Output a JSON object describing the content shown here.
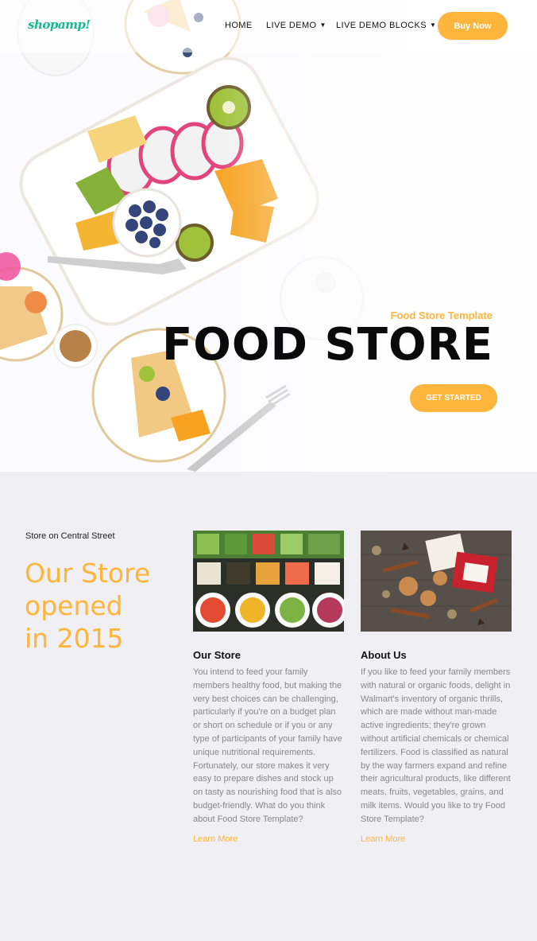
{
  "brand": {
    "logo": "shopamp!",
    "accent": "#fdb53c",
    "logo_color": "#1bb88f"
  },
  "nav": {
    "items": [
      {
        "label": "HOME",
        "has_dropdown": false
      },
      {
        "label": "LIVE DEMO",
        "has_dropdown": true
      },
      {
        "label": "LIVE DEMO BLOCKS",
        "has_dropdown": true
      }
    ],
    "cta": "Buy Now",
    "dropdown_icon": "caret-down-icon"
  },
  "hero": {
    "subtitle": "Food Store Template",
    "title": "FOOD STORE",
    "button": "GET STARTED",
    "image": "food-flatlay-image"
  },
  "intro": {
    "eyebrow": "Store on Central Street",
    "heading_lines": [
      "Our Store",
      "opened",
      "in 2015"
    ]
  },
  "cards": [
    {
      "image": "salad-bar-image",
      "title": "Our Store",
      "text": "You intend to feed your family members healthy food, but making the very best choices can be challenging, particularly if you're on a budget plan or short on schedule or if you or any type of participants of your family have unique nutritional requirements. Fortunately, our store makes it very easy to prepare dishes and stock up on tasty as nourishing food that is also budget-friendly. What do you think about Food Store Template?",
      "link": "Learn More"
    },
    {
      "image": "cookies-spices-image",
      "title": "About Us",
      "text": "If you like to feed your family members with natural or organic foods, delight in Walmart's inventory of organic thrills, which are made without man-made active ingredients; they're grown without artificial chemicals or chemical fertilizers. Food is classified as natural by the way farmers expand and refine their agricultural products, like different meats, fruits, vegetables, grains, and milk items. Would you like to try Food Store Template?",
      "link": "Learn More"
    }
  ]
}
